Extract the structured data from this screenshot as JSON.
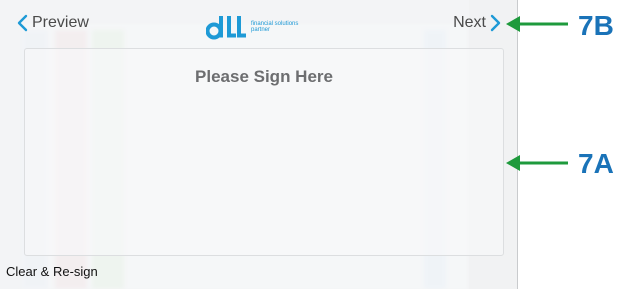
{
  "nav": {
    "prev_label": "Preview",
    "next_label": "Next"
  },
  "logo": {
    "icon": "dll-logo",
    "tagline_line1": "financial solutions",
    "tagline_line2": "partner"
  },
  "signature": {
    "title": "Please Sign Here",
    "clear_label": "Clear & Re-sign"
  },
  "annotations": {
    "next_callout": "7B",
    "pad_callout": "7A"
  },
  "colors": {
    "accent_blue": "#1e9ad6",
    "arrow_green": "#1e9a3c",
    "callout_blue": "#1a73b8"
  }
}
